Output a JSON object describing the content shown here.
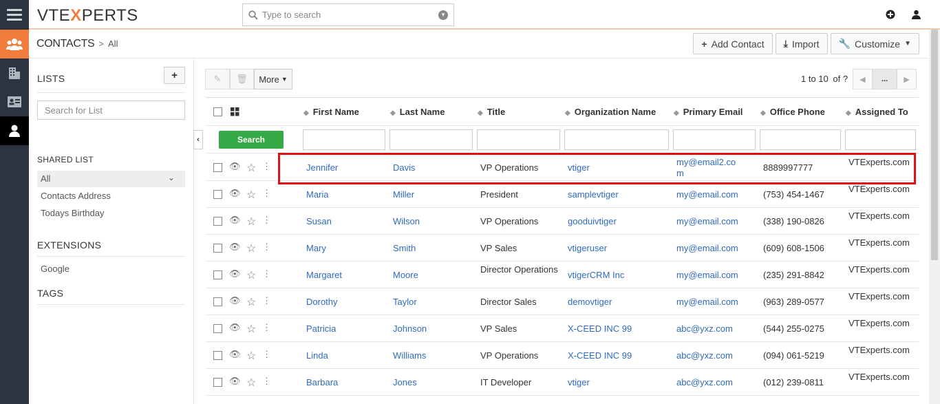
{
  "app": {
    "logo_left": "VTE",
    "logo_x": "X",
    "logo_right": "PERTS",
    "search_placeholder": "Type to search"
  },
  "breadcrumb": {
    "module": "CONTACTS",
    "separator": ">",
    "view": "All"
  },
  "header_buttons": {
    "add": "Add Contact",
    "import": "Import",
    "customize": "Customize"
  },
  "sidebar": {
    "lists_title": "LISTS",
    "search_placeholder": "Search for List",
    "shared_title": "SHARED LIST",
    "shared_items": [
      "All",
      "Contacts Address",
      "Todays Birthday"
    ],
    "extensions_title": "EXTENSIONS",
    "extensions_items": [
      "Google"
    ],
    "tags_title": "TAGS"
  },
  "toolbar": {
    "more": "More"
  },
  "pagination": {
    "range": "1 to 10",
    "of": "of ?",
    "more": "..."
  },
  "table": {
    "search_button": "Search",
    "columns": [
      "First Name",
      "Last Name",
      "Title",
      "Organization Name",
      "Primary Email",
      "Office Phone",
      "Assigned To"
    ],
    "rows": [
      {
        "first": "Jennifer",
        "last": "Davis",
        "title": "VP Operations",
        "org": "vtiger",
        "email": "my@email2.com",
        "phone": "8889997777",
        "assigned": "VTExperts.com"
      },
      {
        "first": "Maria",
        "last": "Miller",
        "title": "President",
        "org": "samplevtiger",
        "email": "my@email.com",
        "phone": "(753) 454-1467",
        "assigned": "VTExperts.com"
      },
      {
        "first": "Susan",
        "last": "Wilson",
        "title": "VP Operations",
        "org": "gooduivtiger",
        "email": "my@email.com",
        "phone": "(338) 190-0826",
        "assigned": "VTExperts.com"
      },
      {
        "first": "Mary",
        "last": "Smith",
        "title": "VP Sales",
        "org": "vtigeruser",
        "email": "my@email.com",
        "phone": "(609) 608-1506",
        "assigned": "VTExperts.com"
      },
      {
        "first": "Margaret",
        "last": "Moore",
        "title": "Director Operations",
        "org": "vtigerCRM Inc",
        "email": "my@email.com",
        "phone": "(235) 291-8842",
        "assigned": "VTExperts.com"
      },
      {
        "first": "Dorothy",
        "last": "Taylor",
        "title": "Director Sales",
        "org": "demovtiger",
        "email": "my@email.com",
        "phone": "(963) 289-0577",
        "assigned": "VTExperts.com"
      },
      {
        "first": "Patricia",
        "last": "Johnson",
        "title": "VP Sales",
        "org": "X-CEED INC 99",
        "email": "abc@yxz.com",
        "phone": "(544) 255-0275",
        "assigned": "VTExperts.com"
      },
      {
        "first": "Linda",
        "last": "Williams",
        "title": "VP Operations",
        "org": "X-CEED INC 99",
        "email": "abc@yxz.com",
        "phone": "(094) 061-5219",
        "assigned": "VTExperts.com"
      },
      {
        "first": "Barbara",
        "last": "Jones",
        "title": "IT Developer",
        "org": "vtiger",
        "email": "abc@yxz.com",
        "phone": "(012) 239-0811",
        "assigned": "VTExperts.com"
      }
    ]
  },
  "icons": {
    "menu": "hamburger-icon",
    "contacts_group": "users-group-icon",
    "organizations": "building-icon",
    "cards": "id-card-icon",
    "contact": "person-icon",
    "search": "search-icon",
    "add": "plus-circle-icon",
    "user": "user-icon"
  },
  "colors": {
    "accent": "#f07d3c",
    "link": "#2e6bbf",
    "search_button": "#35aa47",
    "highlight": "#e01010",
    "rail": "#2b3440"
  }
}
